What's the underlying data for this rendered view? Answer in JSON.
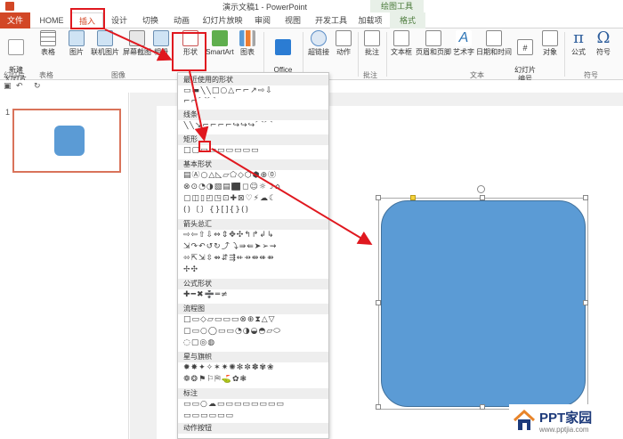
{
  "titlebar": {
    "title": "演示文稿1 - PowerPoint",
    "tools_tab": "绘图工具"
  },
  "tabs": [
    {
      "label": "文件"
    },
    {
      "label": "HOME"
    },
    {
      "label": "插入"
    },
    {
      "label": "设计"
    },
    {
      "label": "切换"
    },
    {
      "label": "动画"
    },
    {
      "label": "幻灯片放映"
    },
    {
      "label": "审阅"
    },
    {
      "label": "视图"
    },
    {
      "label": "开发工具"
    },
    {
      "label": "加载项"
    },
    {
      "label": "格式"
    }
  ],
  "ribbon": {
    "new_slide": "新建\n幻灯片",
    "table": "表格",
    "picture": "图片",
    "online_picture": "联机图片",
    "screenshot": "屏幕截图",
    "album": "相册",
    "shapes": "形状",
    "smartart": "SmartArt",
    "chart": "图表",
    "office_apps": "Office\n应用程序",
    "hyperlink": "超链接",
    "action": "动作",
    "comment": "批注",
    "textbox": "文本框",
    "header_footer": "页眉和页脚",
    "wordart": "艺术字",
    "datetime": "日期和时间",
    "slide_number": "幻灯片\n编号",
    "object": "对象",
    "equation": "公式",
    "symbol": "符号",
    "groups": {
      "slides": "幻灯片",
      "tables": "表格",
      "images": "图像",
      "comments": "批注",
      "text": "文本",
      "symbols": "符号"
    }
  },
  "slide_pane": {
    "slide_number": "1"
  },
  "dropdown": {
    "sections": [
      "最近使用的形状",
      "线条",
      "矩形",
      "基本形状",
      "箭头总汇",
      "公式形状",
      "流程图",
      "星与旗帜",
      "标注",
      "动作按钮"
    ]
  },
  "logo": {
    "brand": "PPT家园",
    "url": "www.pptjia.com"
  },
  "colors": {
    "accent": "#d24726",
    "shape_fill": "#5b9bd5",
    "highlight": "#e0181f"
  }
}
